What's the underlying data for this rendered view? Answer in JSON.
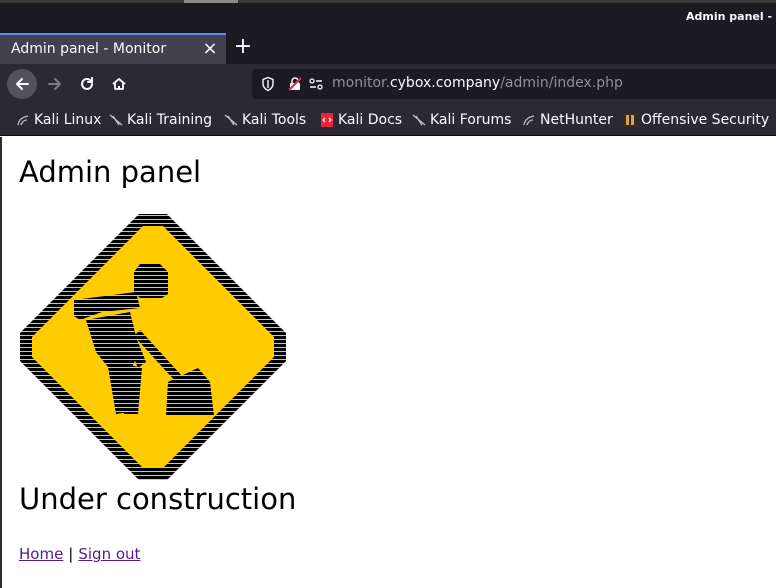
{
  "window": {
    "title": "Admin panel - Mo"
  },
  "tabs": [
    {
      "label": "Admin panel - Monitor",
      "active": true
    }
  ],
  "nav": {
    "url_host_prefix": "monitor.",
    "url_domain": "cybox.company",
    "url_path": "/admin/index.php"
  },
  "bookmarks": [
    {
      "label": "Kali Linux",
      "icon": "kali-dragon-icon"
    },
    {
      "label": "Kali Training",
      "icon": "kali-dragon-icon"
    },
    {
      "label": "Kali Tools",
      "icon": "kali-dragon-icon"
    },
    {
      "label": "Kali Docs",
      "icon": "kali-docs-icon"
    },
    {
      "label": "Kali Forums",
      "icon": "kali-dragon-icon"
    },
    {
      "label": "NetHunter",
      "icon": "kali-dragon-icon"
    },
    {
      "label": "Offensive Security",
      "icon": "offsec-icon"
    }
  ],
  "page": {
    "title": "Admin panel",
    "subtitle": "Under construction",
    "links": {
      "home": "Home",
      "separator": "|",
      "signout": "Sign out"
    }
  },
  "colors": {
    "sign_yellow": "#ffcc00",
    "sign_black": "#000000",
    "link_visited": "#551a8b",
    "chrome_dark": "#1c1b22",
    "chrome_toolbar": "#2b2a33",
    "tab_active": "#42414d"
  }
}
